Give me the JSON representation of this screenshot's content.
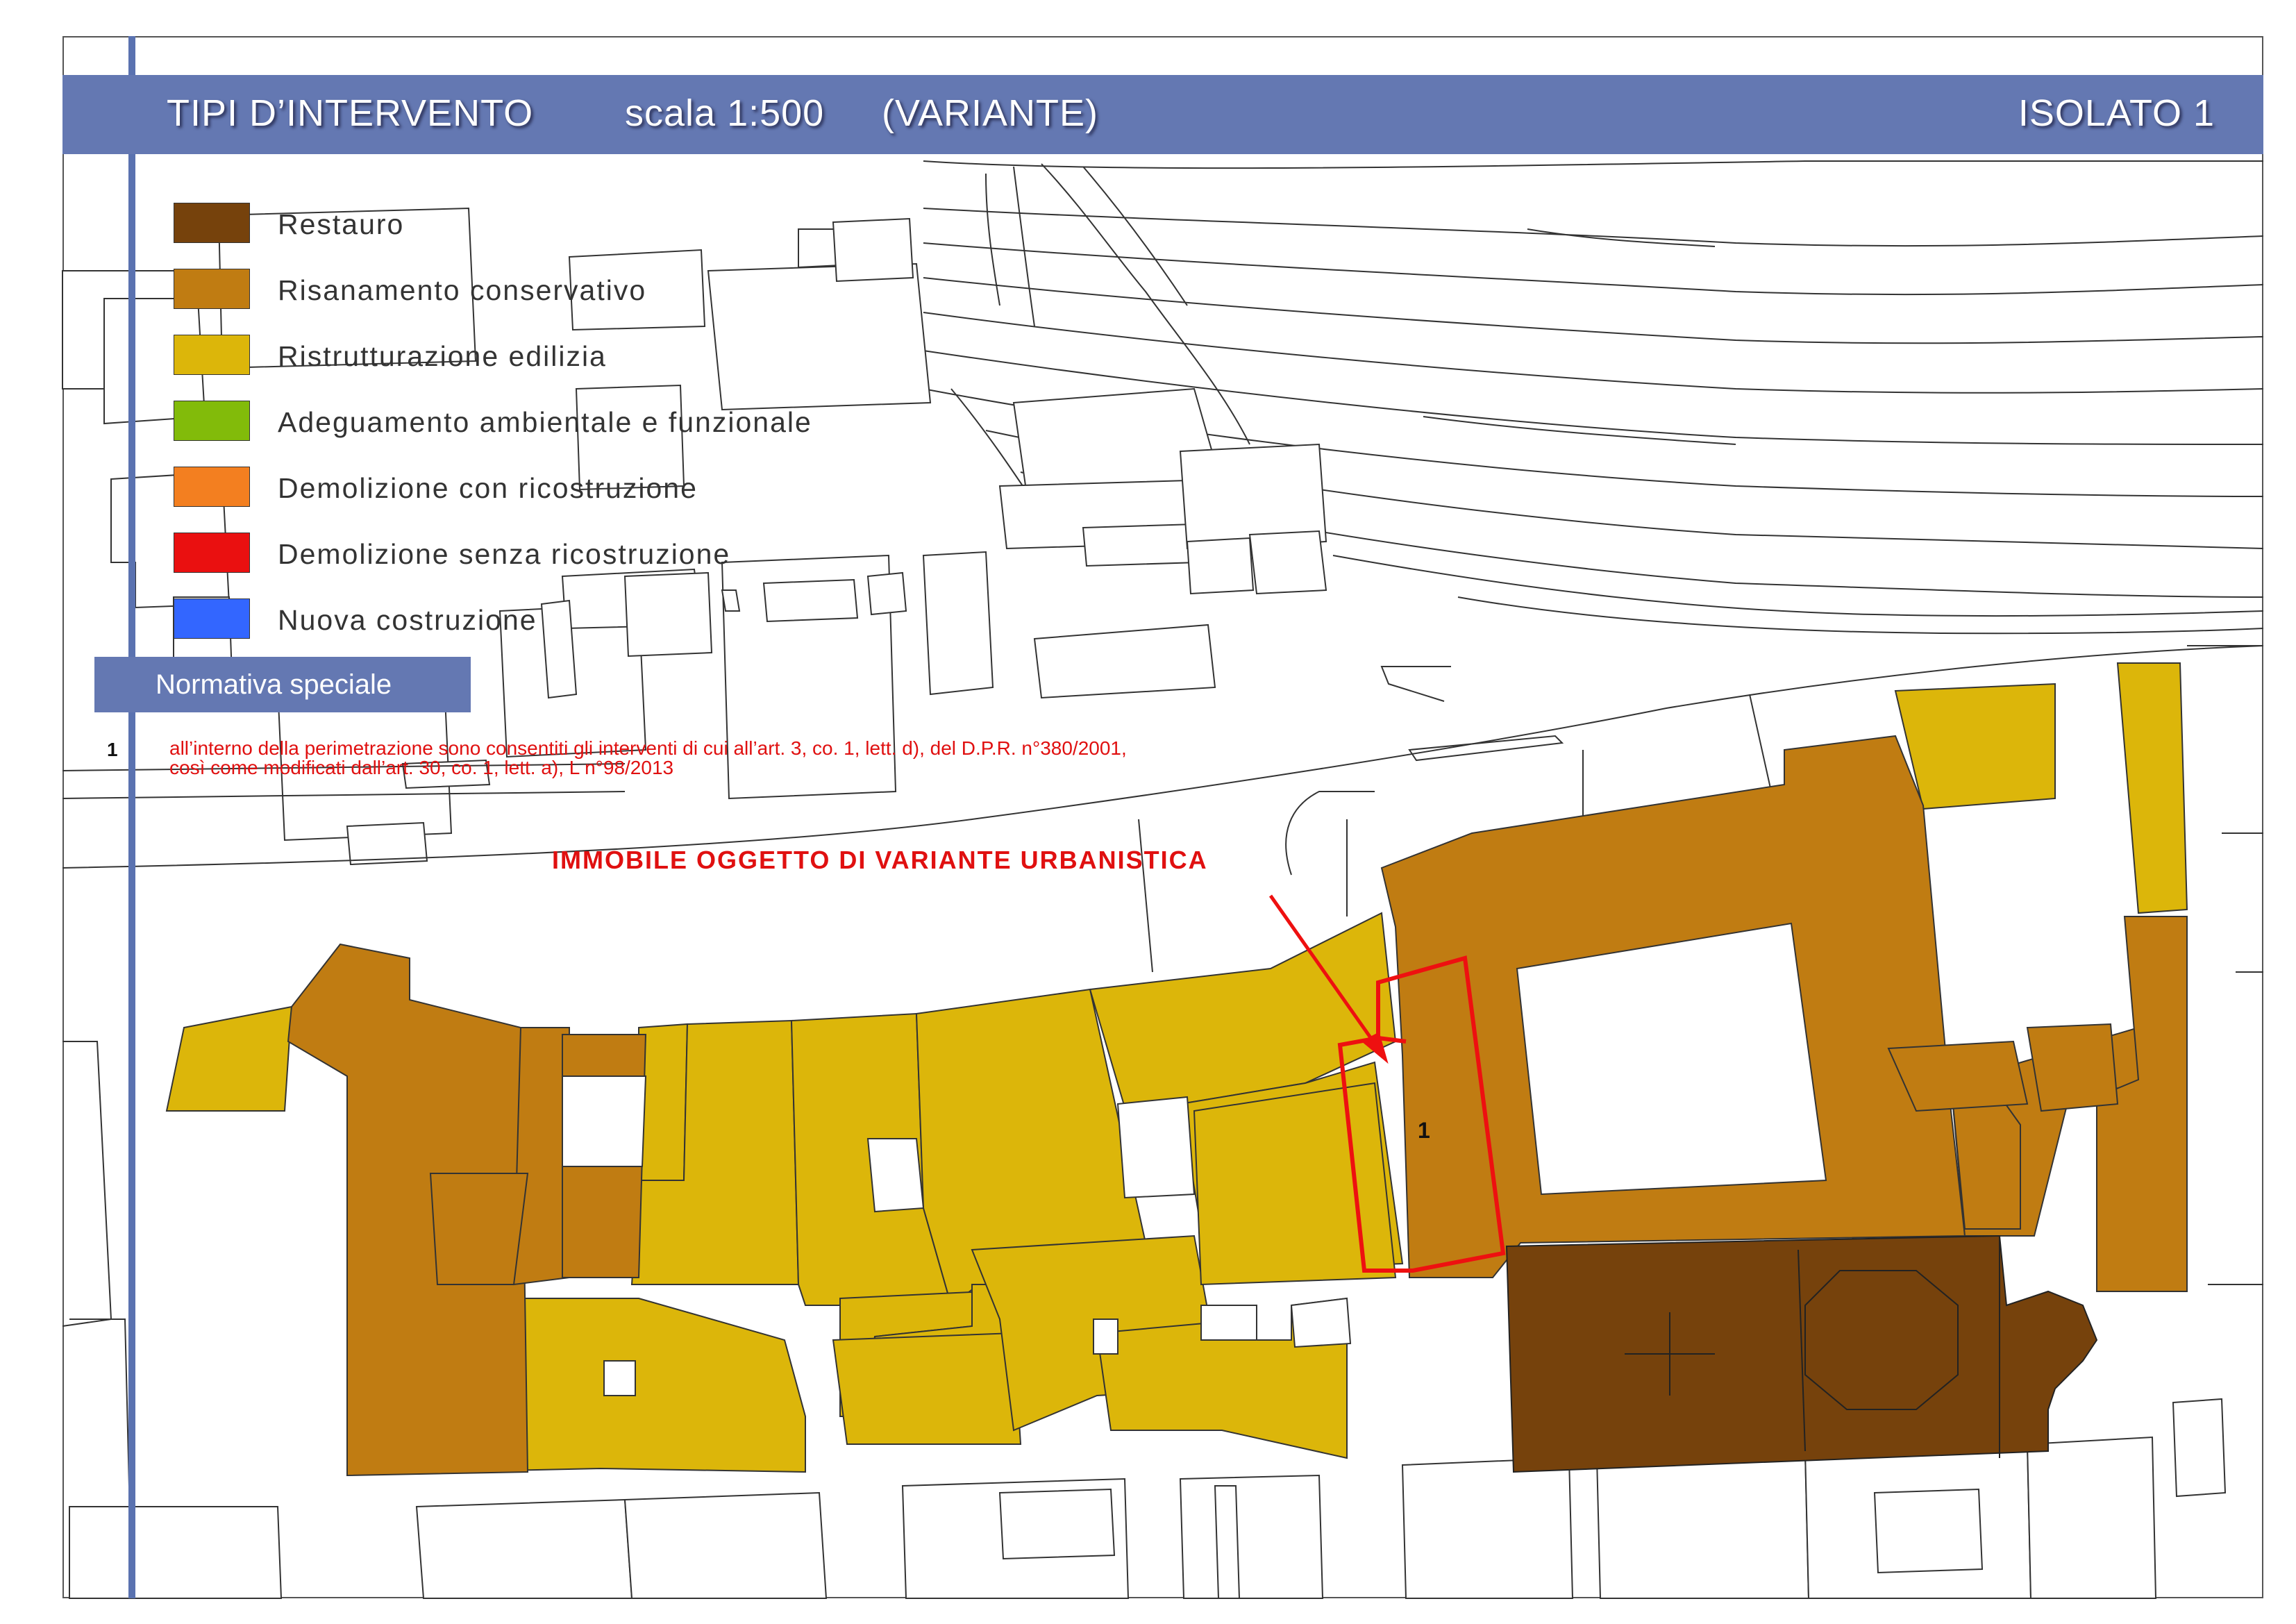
{
  "header": {
    "title": "TIPI D’INTERVENTO",
    "scale": "scala 1:500",
    "variant": "(VARIANTE)",
    "block": "ISOLATO 1"
  },
  "legend": [
    {
      "label": "Restauro",
      "color": "#76420c"
    },
    {
      "label": "Risanamento conservativo",
      "color": "#c07c12"
    },
    {
      "label": "Ristrutturazione edilizia",
      "color": "#dcb60a"
    },
    {
      "label": "Adeguamento ambientale e funzionale",
      "color": "#82bb0a"
    },
    {
      "label": "Demolizione con ricostruzione",
      "color": "#f37f20"
    },
    {
      "label": "Demolizione senza ricostruzione",
      "color": "#ea1010"
    },
    {
      "label": "Nuova costruzione",
      "color": "#3366ff"
    }
  ],
  "special": {
    "heading": "Normativa speciale",
    "number": "1",
    "line1": "all’interno della perimetrazione sono consentiti gli interventi di cui all’art. 3, co. 1, lett. d), del D.P.R. n°380/2001,",
    "line2": "così come modificati dall’art. 30, co. 1, lett. a), L n°98/2013"
  },
  "annotation": "IMMOBILE OGGETTO DI VARIANTE URBANISTICA",
  "parcel_label": "1",
  "colors": {
    "header_bar": "#6478b2",
    "highlight": "#ee1010",
    "line": "#333333"
  }
}
